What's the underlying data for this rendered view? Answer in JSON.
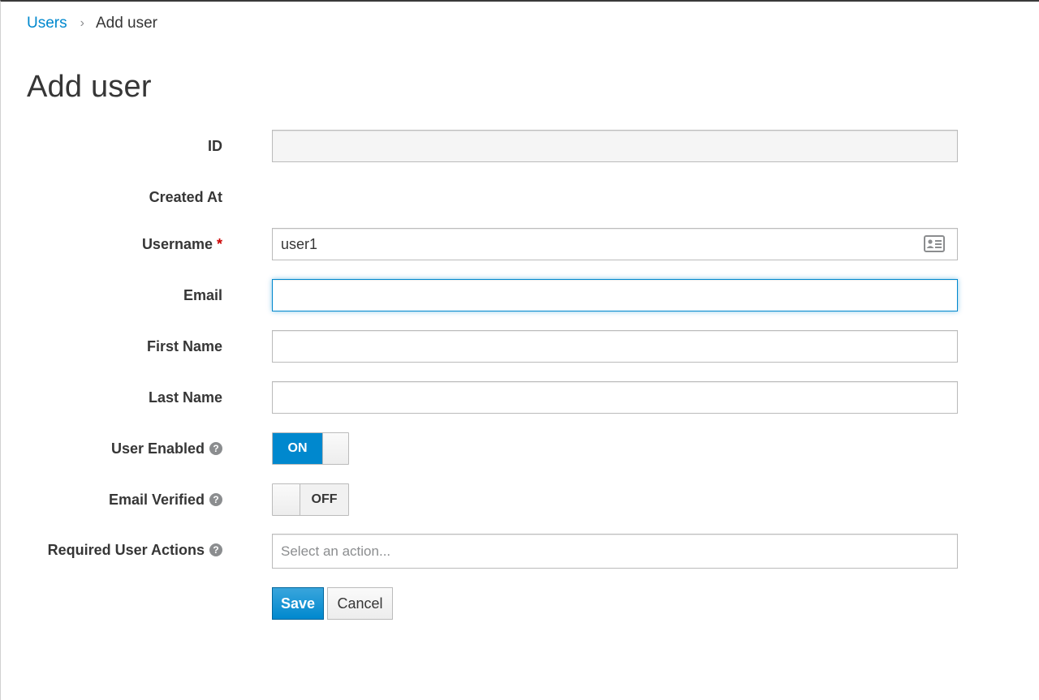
{
  "breadcrumb": {
    "parent": "Users",
    "separator": "›",
    "current": "Add user"
  },
  "page": {
    "title": "Add user"
  },
  "form": {
    "id": {
      "label": "ID",
      "value": ""
    },
    "created_at": {
      "label": "Created At",
      "value": ""
    },
    "username": {
      "label": "Username",
      "required_marker": "*",
      "value": "user1",
      "icon": "contact-card-icon"
    },
    "email": {
      "label": "Email",
      "value": ""
    },
    "first_name": {
      "label": "First Name",
      "value": ""
    },
    "last_name": {
      "label": "Last Name",
      "value": ""
    },
    "user_enabled": {
      "label": "User Enabled",
      "help": "?",
      "state": "ON"
    },
    "email_verified": {
      "label": "Email Verified",
      "help": "?",
      "state": "OFF"
    },
    "required_actions": {
      "label": "Required User Actions",
      "help": "?",
      "placeholder": "Select an action..."
    }
  },
  "actions": {
    "save": "Save",
    "cancel": "Cancel"
  },
  "colors": {
    "accent": "#0088ce",
    "required": "#cc0000",
    "text": "#363636"
  }
}
